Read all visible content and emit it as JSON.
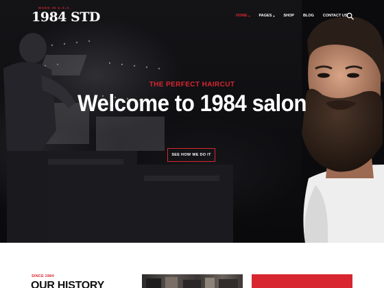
{
  "header": {
    "logo_sub": "MADE IN U.S.A.",
    "logo_main": "1984 STD",
    "nav": [
      {
        "label": "HOME",
        "dropdown": true,
        "active": true
      },
      {
        "label": "PAGES",
        "dropdown": true,
        "active": false
      },
      {
        "label": "SHOP",
        "dropdown": false,
        "active": false
      },
      {
        "label": "BLOG",
        "dropdown": false,
        "active": false
      },
      {
        "label": "CONTACT US",
        "dropdown": false,
        "active": false
      }
    ],
    "search_icon": "search-icon",
    "caret": "▾"
  },
  "hero": {
    "tagline": "THE PERFECT HAIRCUT",
    "title": "Welcome to 1984 salon",
    "button_label": "SEE HOW WE DO IT"
  },
  "history": {
    "since": "SINCE 1984",
    "title": "OUR HISTORY"
  },
  "colors": {
    "accent": "#d7262f",
    "hero_bg": "#0b0b0d",
    "text_light": "#ffffff",
    "text_dark": "#111111"
  }
}
